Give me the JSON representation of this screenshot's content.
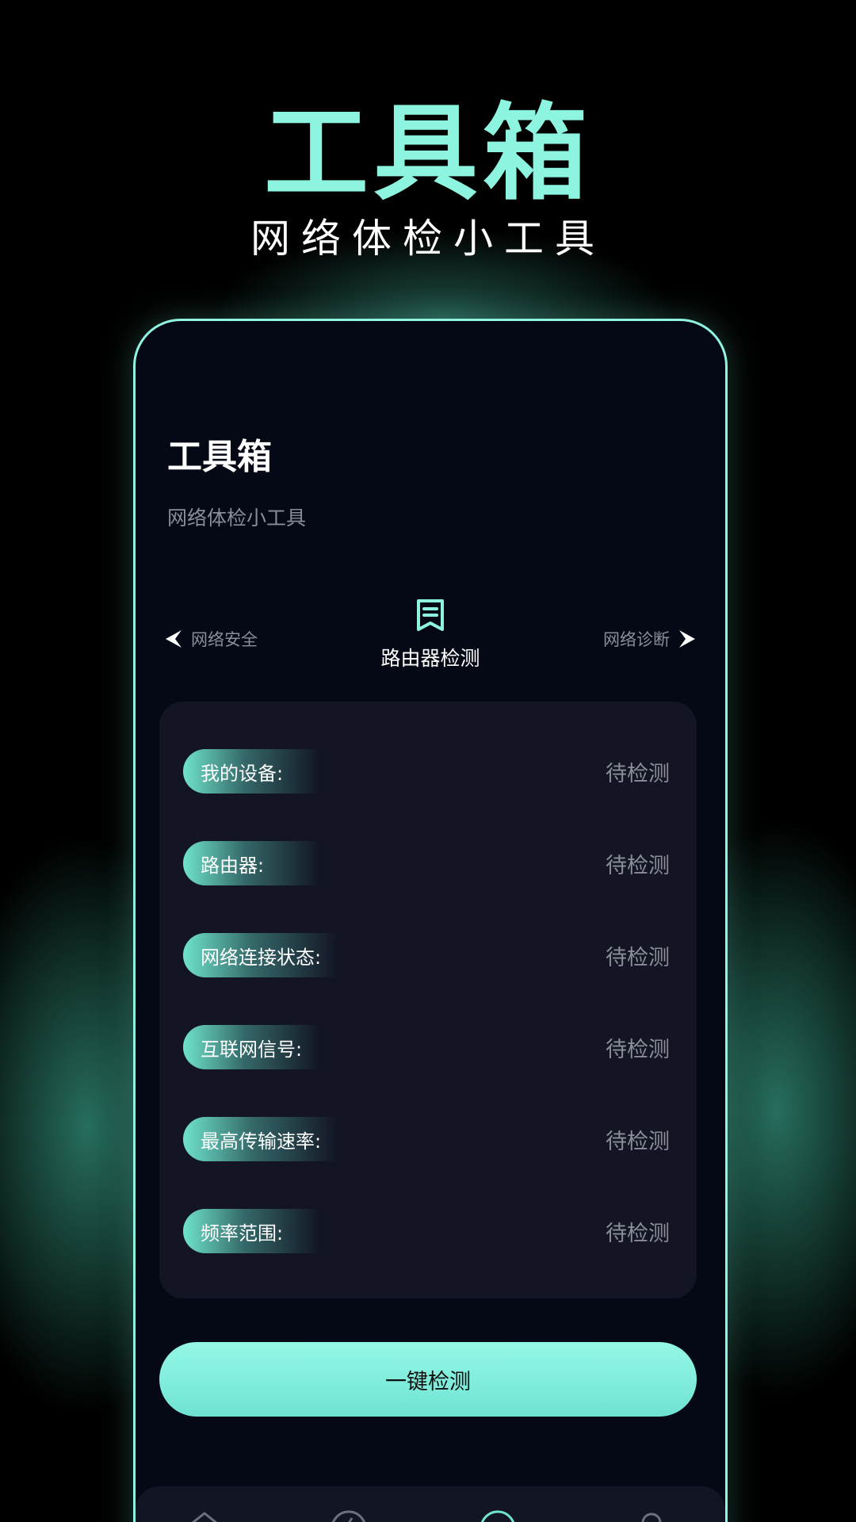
{
  "hero": {
    "title": "工具箱",
    "subtitle": "网络体检小工具"
  },
  "app": {
    "title": "工具箱",
    "subtitle": "网络体检小工具"
  },
  "tab_nav": {
    "prev_label": "网络安全",
    "current_label": "路由器检测",
    "next_label": "网络诊断"
  },
  "checks": [
    {
      "label": "我的设备:",
      "value": "待检测"
    },
    {
      "label": "路由器:",
      "value": "待检测"
    },
    {
      "label": "网络连接状态:",
      "value": "待检测"
    },
    {
      "label": "互联网信号:",
      "value": "待检测"
    },
    {
      "label": "最高传输速率:",
      "value": "待检测"
    },
    {
      "label": "频率范围:",
      "value": "待检测"
    }
  ],
  "cta_label": "一键检测",
  "bottom_tabs": [
    "home-icon",
    "accelerate-icon",
    "toolbox-icon",
    "profile-icon"
  ],
  "colors": {
    "accent": "#8df5df",
    "panel": "#131525",
    "muted": "#8b8e99"
  }
}
